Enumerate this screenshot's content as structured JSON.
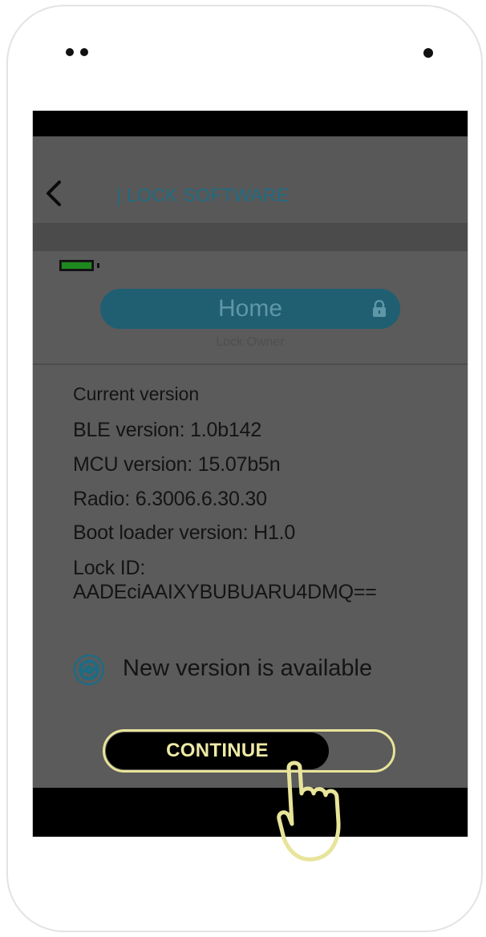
{
  "header": {
    "title": "| LOCK SOFTWARE"
  },
  "lock": {
    "name": "Home",
    "role": "Lock Owner"
  },
  "info": {
    "heading": "Current version",
    "ble": "BLE version:   1.0b142",
    "mcu": "MCU version:  15.07b5n",
    "radio": "Radio: 6.3006.6.30.30",
    "bootloader": "Boot loader version:  H1.0",
    "lock_id_label": "Lock ID:",
    "lock_id_value": "AADEciAAIXYBUBUARU4DMQ=="
  },
  "update": {
    "message": "New version is available"
  },
  "cta": {
    "continue_label": "CONTINUE"
  },
  "icons": [
    "back-arrow-icon",
    "battery-icon",
    "lock-icon",
    "update-refresh-icon",
    "pointing-hand-icon"
  ],
  "battery": {
    "level": 1.0
  },
  "colors": {
    "accent": "#205f72",
    "battery": "#1e8a1e",
    "highlight": "#e8e49a"
  }
}
